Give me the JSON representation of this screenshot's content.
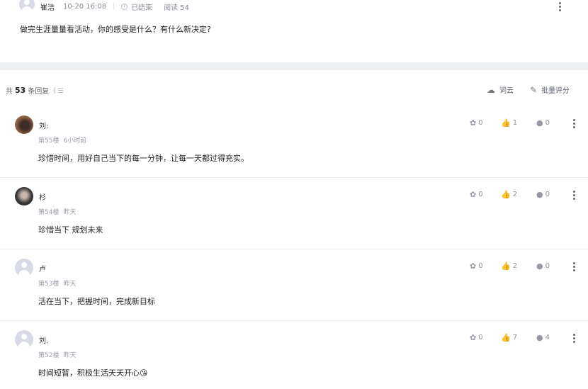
{
  "post": {
    "author": "崔洁",
    "time": "10-20 16:08",
    "status": "已结束",
    "reads": "阅读 54",
    "title": "做完生涯量量看活动，你的感受是什么？有什么新决定?"
  },
  "toolbar": {
    "count_prefix": "共",
    "count_value": "53",
    "count_suffix": "条回复",
    "wordcloud_label": "词云",
    "batch_score_label": "批量评分"
  },
  "replies": [
    {
      "name": "刘:",
      "floor": "第55楼",
      "time": "6小时前",
      "text": "珍惜时间，用好自己当下的每一分钟，让每一天都过得充实。",
      "s1": "0",
      "s2": "1",
      "s3": "0",
      "avatar": "photo1"
    },
    {
      "name": "杉",
      "floor": "第54楼",
      "time": "昨天",
      "text": "珍惜当下 规划未来",
      "s1": "0",
      "s2": "2",
      "s3": "0",
      "avatar": "photo2"
    },
    {
      "name": "卢",
      "floor": "第53楼",
      "time": "昨天",
      "text": "活在当下，把握时间，完成新目标",
      "s1": "0",
      "s2": "2",
      "s3": "0",
      "avatar": "default"
    },
    {
      "name": "刘.",
      "floor": "第52楼",
      "time": "昨天",
      "text": "时间短暂，积极生活天天开心😘",
      "s1": "0",
      "s2": "7",
      "s3": "4",
      "avatar": "default"
    }
  ]
}
